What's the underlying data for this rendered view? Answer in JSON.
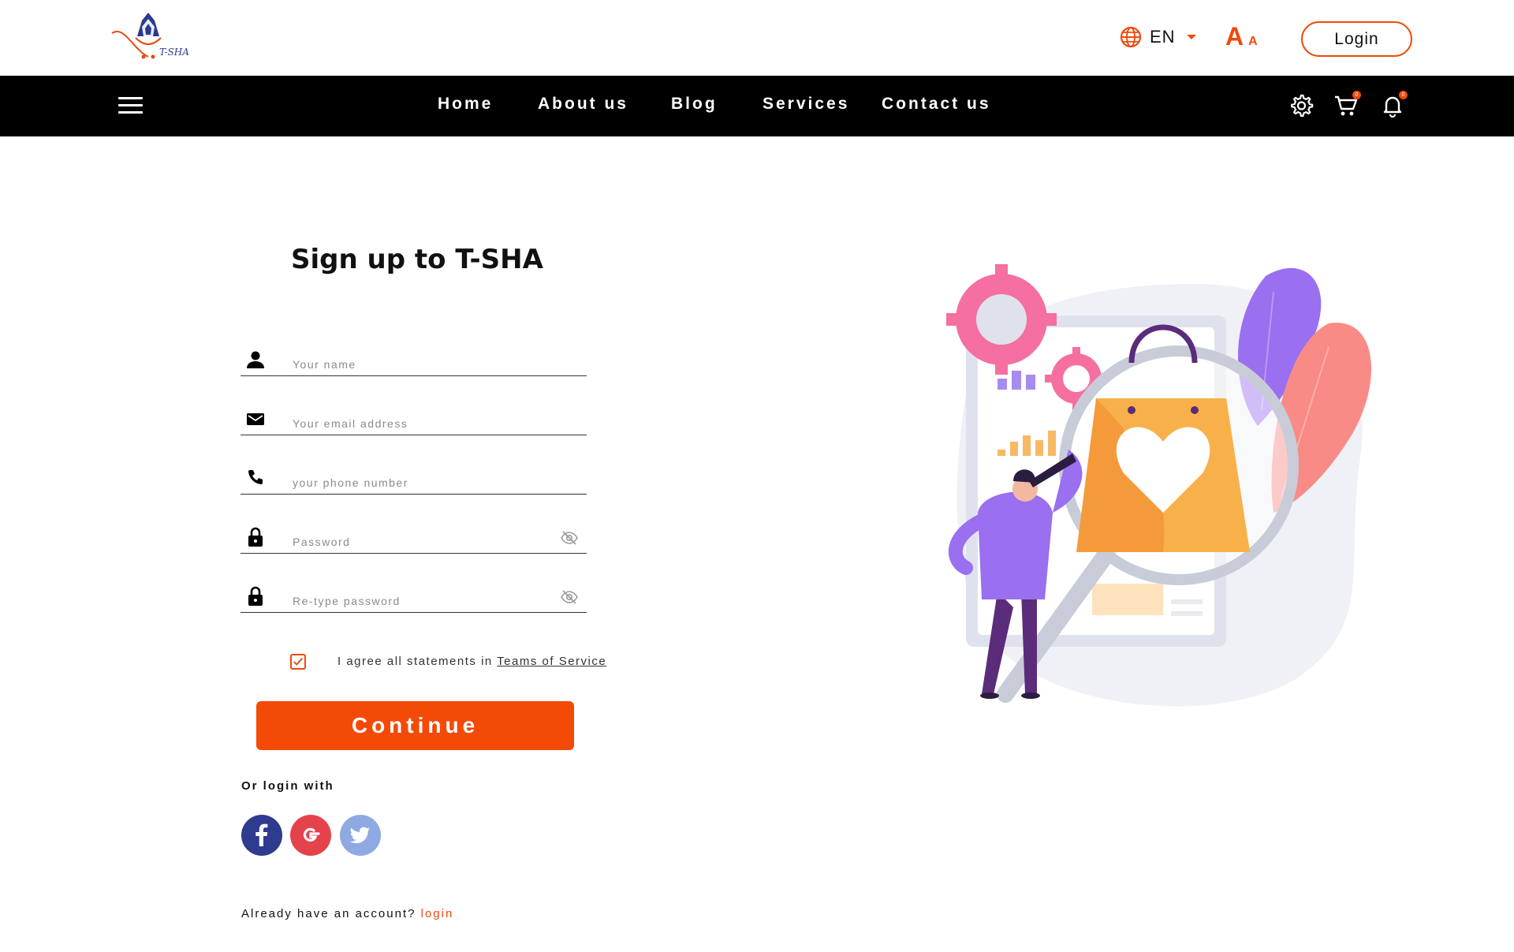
{
  "header": {
    "logo_text": "T-SHA",
    "language": "EN",
    "font_size_large": "A",
    "font_size_small": "A",
    "login_label": "Login"
  },
  "nav": {
    "items": [
      {
        "label": "Home"
      },
      {
        "label": "About us"
      },
      {
        "label": "Blog"
      },
      {
        "label": "Services"
      },
      {
        "label": "Contact us"
      }
    ],
    "cart_count": "0",
    "notification_count": "0"
  },
  "form": {
    "title": "Sign up to T-SHA",
    "fields": {
      "name_placeholder": "Your name",
      "email_placeholder": "Your email address",
      "phone_placeholder": "your phone number",
      "password_placeholder": "Password",
      "retype_placeholder": "Re-type password"
    },
    "agree_text": "I agree all statements in",
    "terms_link": "Teams of Service",
    "agree_checked": true,
    "continue_label": "Continue",
    "or_login_with": "Or login with",
    "social": [
      {
        "icon": "facebook-icon",
        "letter": "f",
        "color": "#2e3b8f"
      },
      {
        "icon": "google-icon",
        "letter": "G",
        "color": "#e5434b"
      },
      {
        "icon": "twitter-icon",
        "color": "#8fa9e3"
      }
    ],
    "already_text": "Already have an account?",
    "login_link": "login"
  },
  "theme": {
    "accent": "#f04a0d",
    "nav_bg": "#000000"
  }
}
